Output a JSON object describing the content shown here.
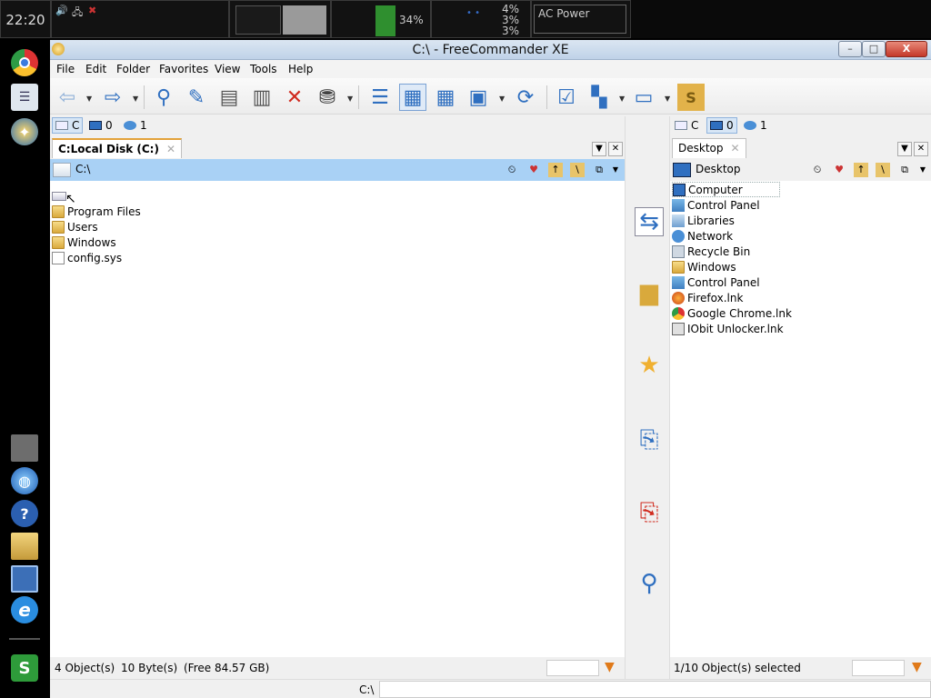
{
  "topbar": {
    "clock": "22:20",
    "memory_pct": "34%",
    "net_values": [
      "4%",
      "3%",
      "3%"
    ],
    "power": "AC Power"
  },
  "window": {
    "title": "C:\\ - FreeCommander XE",
    "min_label": "–",
    "max_label": "□",
    "close_label": "X"
  },
  "menu": [
    "File",
    "Edit",
    "Folder",
    "Favorites",
    "View",
    "Tools",
    "Help"
  ],
  "left": {
    "drives": [
      {
        "label": "C"
      },
      {
        "label": "0"
      },
      {
        "label": "1"
      }
    ],
    "tab": "C:Local Disk (C:)",
    "path": "C:\\",
    "files": [
      {
        "name": "Program Files",
        "type": "folder"
      },
      {
        "name": "Users",
        "type": "folder"
      },
      {
        "name": "Windows",
        "type": "folder"
      },
      {
        "name": "config.sys",
        "type": "file"
      }
    ],
    "status": {
      "objects": "4 Object(s)",
      "bytes": "10 Byte(s)",
      "free": "(Free 84.57 GB)"
    }
  },
  "right": {
    "drives": [
      {
        "label": "C"
      },
      {
        "label": "0"
      },
      {
        "label": "1"
      }
    ],
    "tab": "Desktop",
    "path": "Desktop",
    "files": [
      {
        "name": "Computer",
        "type": "computer"
      },
      {
        "name": "Control Panel",
        "type": "control"
      },
      {
        "name": "Libraries",
        "type": "library"
      },
      {
        "name": "Network",
        "type": "network"
      },
      {
        "name": "Recycle Bin",
        "type": "recycle"
      },
      {
        "name": "Windows",
        "type": "folder"
      },
      {
        "name": "Control Panel",
        "type": "control"
      },
      {
        "name": "Firefox.lnk",
        "type": "firefox"
      },
      {
        "name": "Google Chrome.lnk",
        "type": "chrome"
      },
      {
        "name": "IObit Unlocker.lnk",
        "type": "iobit"
      }
    ],
    "status": {
      "selected": "1/10 Object(s) selected"
    }
  },
  "cmdline": {
    "label": "C:\\"
  },
  "colors": {
    "accent": "#2f6fc0",
    "path_highlight": "#a9d1f5",
    "tab_top": "#e3a23a"
  }
}
